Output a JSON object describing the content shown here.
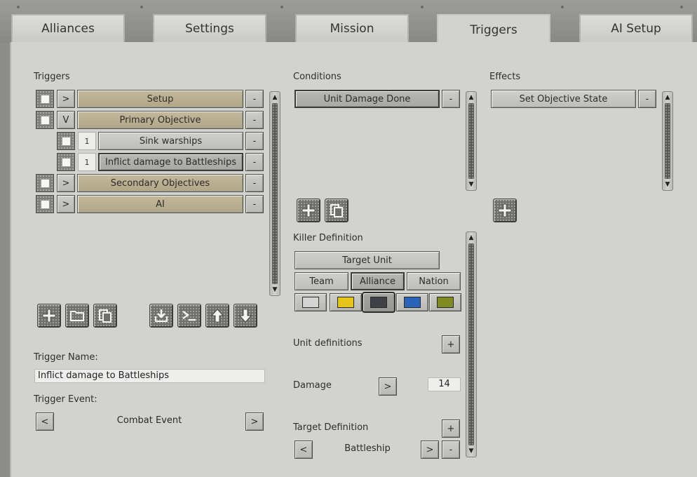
{
  "tabs": [
    {
      "label": "Alliances",
      "active": false
    },
    {
      "label": "Settings",
      "active": false
    },
    {
      "label": "Mission",
      "active": false
    },
    {
      "label": "Triggers",
      "active": true
    },
    {
      "label": "AI Setup",
      "active": false
    }
  ],
  "triggers": {
    "header": "Triggers",
    "rows": [
      {
        "toggle": ">",
        "label": "Setup",
        "remove": "-"
      },
      {
        "toggle": "V",
        "label": "Primary Objective",
        "remove": "-"
      },
      {
        "index": "1",
        "label": "Sink warships",
        "remove": "-"
      },
      {
        "index": "1",
        "label": "Inflict damage to Battleships",
        "remove": "-"
      },
      {
        "toggle": ">",
        "label": "Secondary Objectives",
        "remove": "-"
      },
      {
        "toggle": ">",
        "label": "AI",
        "remove": "-"
      }
    ],
    "name_label": "Trigger Name:",
    "name_value": "Inflict damage to Battleships",
    "event_label": "Trigger Event:",
    "event_prev": "<",
    "event_value": "Combat Event",
    "event_next": ">"
  },
  "conditions": {
    "header": "Conditions",
    "items": [
      {
        "label": "Unit Damage Done",
        "remove": "-"
      }
    ],
    "killer_header": "Killer Definition",
    "target_unit": "Target Unit",
    "scope_buttons": [
      "Team",
      "Alliance",
      "Nation"
    ],
    "swatches": [
      "#d4d4d4",
      "#e6c41a",
      "#3e4248",
      "#2a64b8",
      "#7f8a22"
    ],
    "unit_definitions_label": "Unit definitions",
    "unit_definitions_add": "+",
    "damage_label": "Damage",
    "damage_arrow": ">",
    "damage_value": "14",
    "target_definition_label": "Target Definition",
    "target_definition_add": "+",
    "target_prev": "<",
    "target_value": "Battleship",
    "target_next": ">",
    "target_remove": "-"
  },
  "effects": {
    "header": "Effects",
    "items": [
      {
        "label": "Set Objective State",
        "remove": "-"
      }
    ]
  },
  "icons": {
    "scroll_up": "▲",
    "scroll_down": "▼"
  }
}
